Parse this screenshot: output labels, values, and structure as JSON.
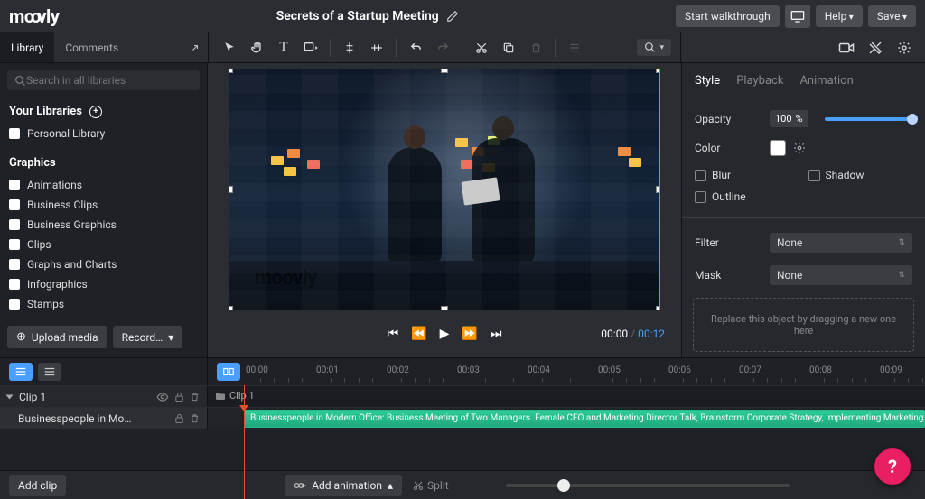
{
  "app": {
    "logo": "moovly"
  },
  "header": {
    "title": "Secrets of a Startup Meeting",
    "walkthrough": "Start walkthrough",
    "help": "Help",
    "save": "Save"
  },
  "tabs": {
    "library": "Library",
    "comments": "Comments"
  },
  "search": {
    "placeholder": "Search in all libraries"
  },
  "sidebar": {
    "yourLibraries": "Your Libraries",
    "personal": "Personal Library",
    "graphics": "Graphics",
    "items": [
      "Animations",
      "Business Clips",
      "Business Graphics",
      "Clips",
      "Graphs and Charts",
      "Infographics",
      "Stamps"
    ],
    "upload": "Upload media",
    "record": "Record…"
  },
  "player": {
    "current": "00:00",
    "total": "00:12"
  },
  "props": {
    "tabs": {
      "style": "Style",
      "playback": "Playback",
      "animation": "Animation"
    },
    "opacity": {
      "label": "Opacity",
      "value": "100",
      "unit": "%"
    },
    "color": "Color",
    "blur": "Blur",
    "shadow": "Shadow",
    "outline": "Outline",
    "filter": {
      "label": "Filter",
      "value": "None"
    },
    "mask": {
      "label": "Mask",
      "value": "None"
    },
    "dropHint": "Replace this object by dragging a new one here"
  },
  "timeline": {
    "clip1": "Clip 1",
    "childName": "Businesspeople in Modern Office:…",
    "segText": "Businesspeople in Modern Office: Business Meeting of Two Managers. Female CEO and Marketing Director Talk, Brainstorm Corporate Strategy, Implementing Marketing and",
    "ticks": [
      "00:00",
      "00:01",
      "00:02",
      "00:03",
      "00:04",
      "00:05",
      "00:06",
      "00:07",
      "00:08",
      "00:09"
    ]
  },
  "bottom": {
    "addClip": "Add clip",
    "addAnimation": "Add animation",
    "split": "Split"
  }
}
